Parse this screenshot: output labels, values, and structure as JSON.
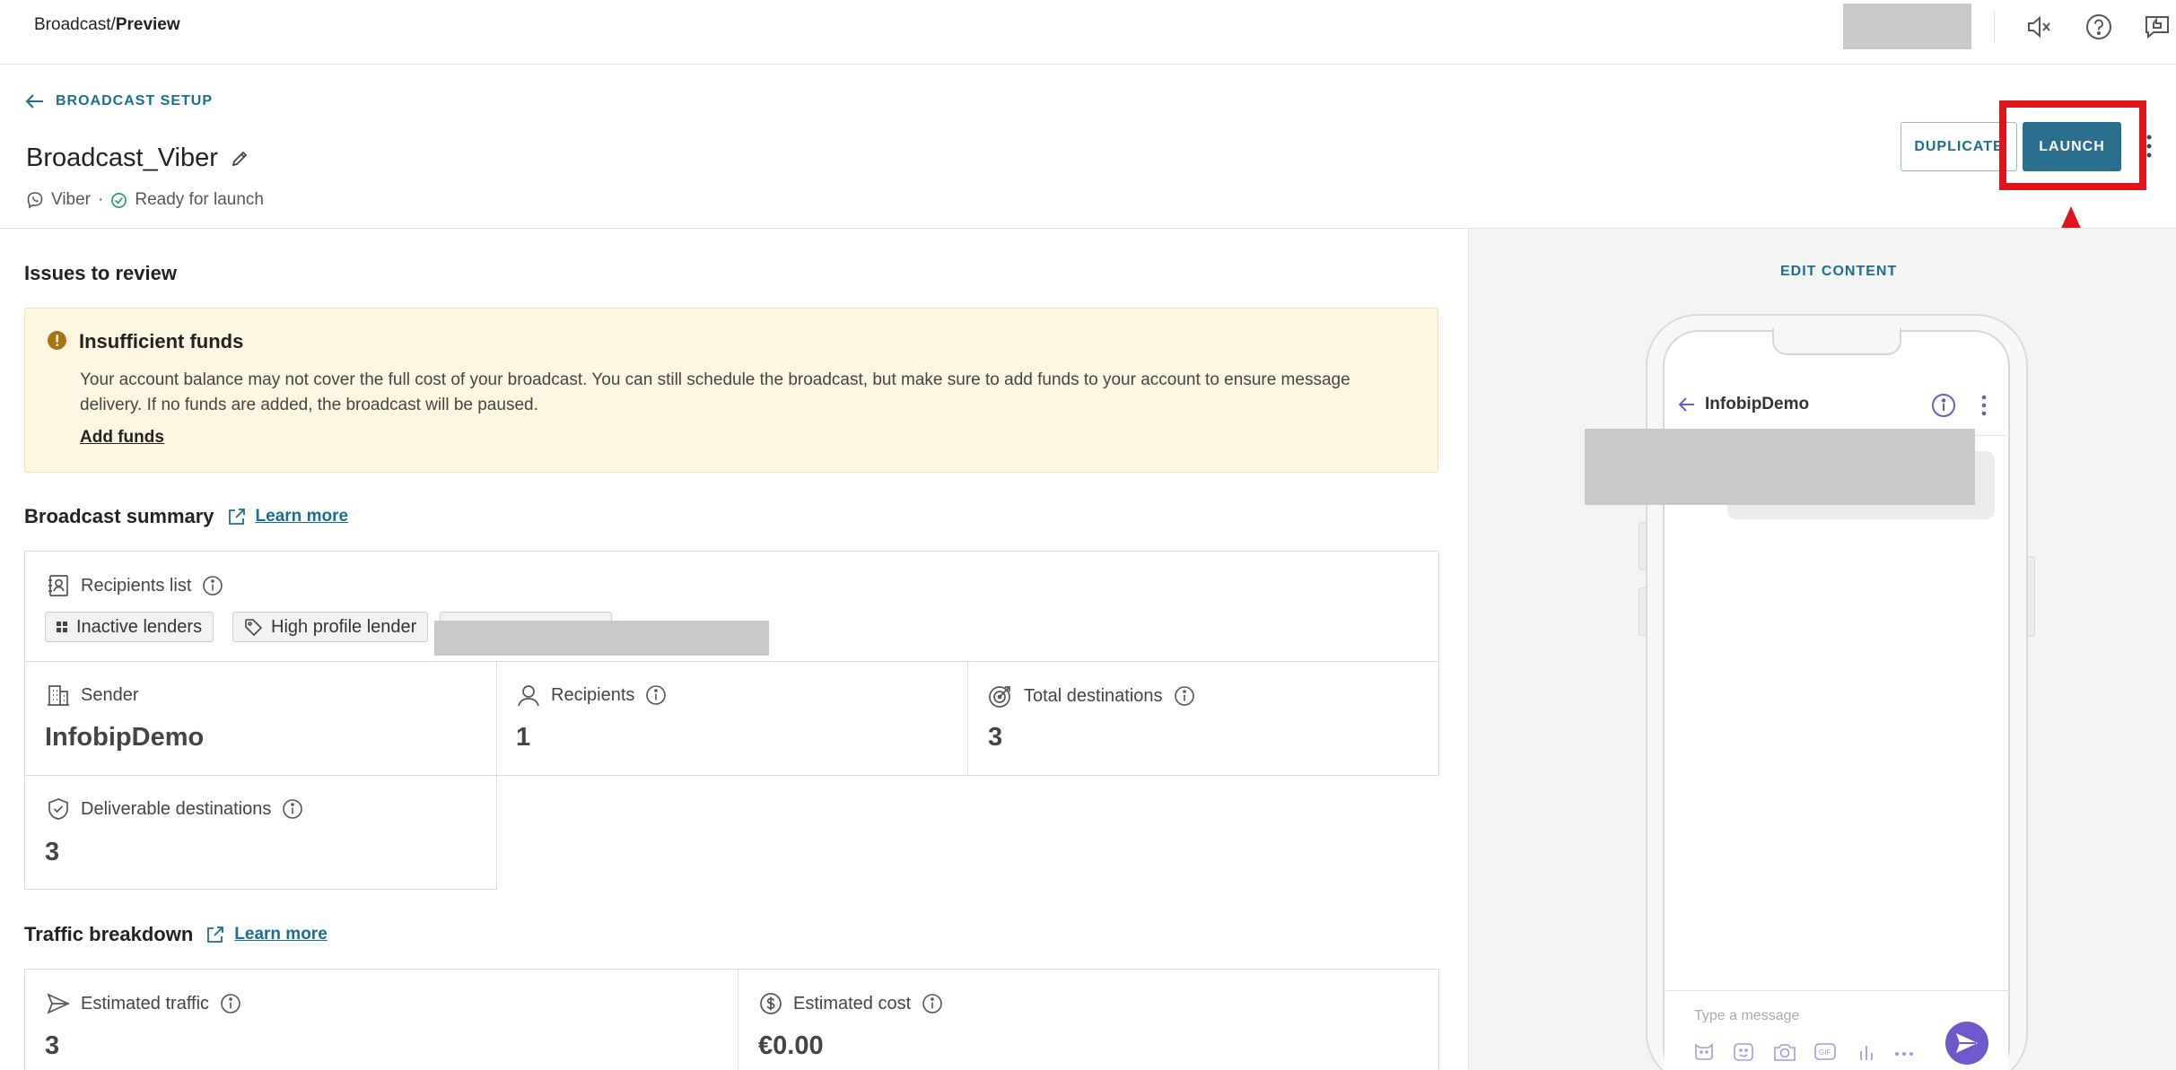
{
  "topbar": {
    "breadcrumb_parent": "Broadcast",
    "breadcrumb_sep": "/",
    "breadcrumb_current": "Preview"
  },
  "header": {
    "back_label": "BROADCAST SETUP",
    "title": "Broadcast_Viber",
    "channel": "Viber",
    "dot": "·",
    "status": "Ready for launch",
    "duplicate_label": "DUPLICATE",
    "launch_label": "LAUNCH"
  },
  "issues": {
    "heading": "Issues to review",
    "warning_title": "Insufficient funds",
    "warning_text": "Your account balance may not cover the full cost of your broadcast. You can still schedule the broadcast, but make sure to add funds to your account to ensure message delivery. If no funds are added, the broadcast will be paused.",
    "warning_link": "Add funds"
  },
  "summary": {
    "heading": "Broadcast summary",
    "learn_more": "Learn more",
    "recipients_list_label": "Recipients list",
    "tags": [
      "Inactive lenders",
      "High profile lender"
    ],
    "sender_label": "Sender",
    "sender_value": "InfobipDemo",
    "recipients_label": "Recipients",
    "recipients_value": "1",
    "total_dest_label": "Total destinations",
    "total_dest_value": "3",
    "deliverable_label": "Deliverable destinations",
    "deliverable_value": "3"
  },
  "traffic": {
    "heading": "Traffic breakdown",
    "learn_more": "Learn more",
    "estimated_traffic_label": "Estimated traffic",
    "estimated_traffic_value": "3",
    "estimated_cost_label": "Estimated cost",
    "estimated_cost_value": "€0.00"
  },
  "preview": {
    "edit_label": "EDIT CONTENT",
    "chat_name": "InfobipDemo",
    "input_placeholder": "Type a message"
  },
  "colors": {
    "accent": "#2a6f8e",
    "link": "#1b6e8f",
    "warning_bg": "#fdf6e0",
    "highlight": "#e0141c",
    "viber_purple": "#6f58c9",
    "success": "#2e9e6a"
  },
  "icons": [
    "arrow-left-icon",
    "edit-pencil-icon",
    "viber-icon",
    "check-circle-icon",
    "mute-icon",
    "help-icon",
    "feedback-icon",
    "kebab-icon",
    "warning-icon",
    "external-link-icon",
    "contacts-icon",
    "info-icon",
    "tag-icon",
    "building-icon",
    "person-icon",
    "target-icon",
    "shield-check-icon",
    "send-icon",
    "dollar-icon"
  ]
}
